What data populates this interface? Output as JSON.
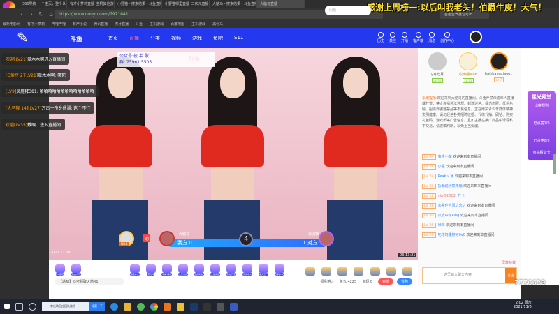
{
  "browser": {
    "tabs": [
      "360导航_一个主页，整个世界",
      "有才小萝莉直播_主机其他游戏",
      "小野猫 - 搜索结果 - 斗鱼直播",
      "小野猫哪里直播_二次元直播",
      "大脑马 - 搜索结果 - 斗鱼直播",
      "大脑马直播"
    ],
    "url": "https://www.douyu.com/7971641",
    "search_placeholder": "首座空气露营可出",
    "bookmarks": [
      "最新电影网",
      "有才小萝莉",
      "哔哩哔哩",
      "有声小说",
      "腾讯直播",
      "虎牙直播",
      "斗鱼",
      "主机游戏",
      "百度地图",
      "主机游戏",
      "黑化马"
    ]
  },
  "banner": "感谢上周榜一:以后叫我老头！伯爵牛皮！大气！",
  "header": {
    "logo": "斗鱼",
    "menu": [
      "首页",
      "直播",
      "分类",
      "视频",
      "游戏",
      "鱼吧",
      "S11"
    ],
    "search_placeholder": "问题",
    "icons": [
      "历史",
      "关注",
      "开播",
      "客户端",
      "消息",
      "创作中心"
    ]
  },
  "video": {
    "tag": "打卡",
    "qq_line1": "公众号:夜 半 歌",
    "qq_line2": "群: 75961 5505",
    "timestamp": "2021.11.06",
    "corner_time": "03:13:21"
  },
  "chat_overlay": [
    {
      "tag": "欢迎[LV21]",
      "text": "章木木啊进入直播间"
    },
    {
      "tag": "[G爱豆 2][LV21]",
      "text": "章木木啊: 笑死"
    },
    {
      "tag": "[LV9]",
      "text": "灵鹿拜381: 哈哈哈哈哈哈哈哈哈哈哈哈哈"
    },
    {
      "tag": "[大马猴 14][LV27]",
      "text": "万古一帝乡鼎湖: 这个不行"
    },
    {
      "tag": "欢迎[LV35]",
      "text": "戴眼、进入直播间"
    }
  ],
  "pk": {
    "left_name": "大脑马",
    "right_name": "凌羽楠",
    "left_score": "我方 0",
    "right_score": "1 对方",
    "round": "4",
    "helper": "NO.1",
    "assist": "助"
  },
  "gifts": [
    "PK活动",
    "自由大厅",
    "超级办公",
    "荧光棒",
    "喝彩·爆款",
    "太空漫步",
    "钻石粉丝",
    "全部贵族",
    "粉丝开宝",
    "鲁鲁救火",
    "鱼丸工厂",
    "福利PK"
  ],
  "info": {
    "notice": "【通知】@可领取火箭X1",
    "welfare": "福利券>",
    "fish_ball": "鱼丸 4225",
    "fish_wing": "鱼翅 0",
    "recharge": "充值",
    "backpack": "背包"
  },
  "ranks": [
    {
      "name": "y寒七月",
      "lv": "LV 32"
    },
    {
      "name": "哎呦喂alan",
      "lv": "LV 32"
    },
    {
      "name": "baishangxiaog...",
      "lv": "LV 7"
    }
  ],
  "system_msg": {
    "label": "系统提示:",
    "text": "欢迎来到大脑马的直播间。斗鱼严禁未成年人直播或打赏，禁止传播违法违规、封建迷信、暴力血腥、低俗色情、招嫖诈骗违禁品等不良信息。正在维护青少年群体精神文明健康。请勿轻信各类招聘征婚、代练代抽、刷钻、购买礼包码、游戏币等广告信息。且如主播在推广商品中诱导私下交易，请谨慎判断，以免上当受骗。"
  },
  "chat": [
    {
      "lv": "LV 34",
      "user": "有才小萌",
      "text": "欢迎来到本直播间"
    },
    {
      "lv": "LV 26",
      "user": "小猩",
      "text": "欢迎来到本直播间"
    },
    {
      "lv": "LV 24",
      "user": "Peak~ 冰",
      "text": "欢迎来到本直播间"
    },
    {
      "lv": "LV 23",
      "user": "折戟成沙铁未销",
      "text": "欢迎来到本直播间"
    },
    {
      "lv": "LV 12",
      "user": "nini52013:",
      "text": "打卡"
    },
    {
      "lv": "LV 26",
      "user": "心系佳人思之念之",
      "text": "欢迎来到本直播间"
    },
    {
      "lv": "LV 30",
      "user": "瓜皮中单king",
      "text": "欢迎来到本直播间"
    },
    {
      "lv": "LV 26",
      "user": "米凹",
      "text": "欢迎来到本直播间"
    },
    {
      "lv": "LV 26",
      "user": "吃饱饱睡好好0v0",
      "text": "欢迎来到本直播间"
    }
  ],
  "chat_input": {
    "placeholder": "这里输入聊天内容",
    "send": "发送",
    "shield": "屏蔽特效"
  },
  "ad": {
    "title": "星光殿堂",
    "sub": "比拼规则",
    "p1": "已点亮1/9",
    "p2": "已点亮0/9",
    "foot": "点亮殿堂卡"
  },
  "taskbar": {
    "search": "李佳琦回应团队被抓",
    "search_btn": "搜索一下",
    "time": "2:02 周六",
    "date": "2021/11/6"
  },
  "watermark": "7776629"
}
